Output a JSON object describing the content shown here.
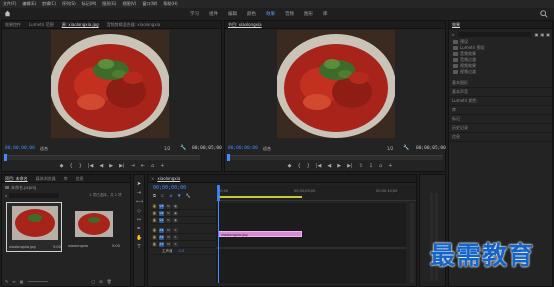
{
  "menu": [
    "文件(F)",
    "编辑(E)",
    "剪辑(C)",
    "序列(S)",
    "标记(M)",
    "图形(G)",
    "视图(V)",
    "窗口(W)",
    "帮助(H)"
  ],
  "workspaces": [
    "学习",
    "组件",
    "编辑",
    "颜色",
    "效果",
    "音频",
    "图形",
    "库"
  ],
  "active_workspace": "效果",
  "source_panel": {
    "tabs": [
      "效果控件",
      "Lumetri 范围",
      "源: xiaolongxia.jpg",
      "音频剪辑混合器: xiaolongxia"
    ],
    "timecode_left": "00;00;00;00",
    "fit": "适合",
    "ratio": "1/2",
    "timecode_right": "00;00;05;00",
    "buttons": [
      "◆",
      "{",
      "}",
      "|◀",
      "◀",
      "▶",
      "▶|",
      "⇥",
      "⇤",
      "⌂",
      "+"
    ]
  },
  "program_panel": {
    "title": "节目: xiaolongxia",
    "timecode_left": "00;00;00;00",
    "fit": "适合",
    "ratio": "1/2",
    "timecode_right": "00;00;05;00",
    "buttons": [
      "◆",
      "{",
      "}",
      "|◀",
      "◀",
      "▶",
      "▶|",
      "⇧",
      "⇩",
      "⌂",
      "+"
    ]
  },
  "right_panel": {
    "header": "效果",
    "tree": [
      "预设",
      "Lumetri 预设",
      "音频效果",
      "音频过渡",
      "视频效果",
      "视频过渡"
    ],
    "sections": [
      "基本图形",
      "基本声音",
      "Lumetri 颜色",
      "库",
      "标记",
      "历史记录",
      "信息"
    ]
  },
  "project_panel": {
    "tabs": [
      "项目: 未命名",
      "媒体浏览器",
      "库",
      "信息"
    ],
    "project_file": "未命名.prproj",
    "selected_count": "1 项已选择，共 2 项",
    "items": [
      {
        "name": "xiaolongxia.jpg",
        "duration": "5:00"
      },
      {
        "name": "xiaolongxia",
        "duration": "5:00"
      }
    ]
  },
  "timeline": {
    "tab": "xiaolongxia",
    "timecode": "00;00;00;00",
    "ruler": [
      "00;00",
      "00;00;05;00",
      "00;00;10;00"
    ],
    "video_tracks": [
      "V3",
      "V2",
      "V1"
    ],
    "audio_tracks": [
      "A1",
      "A2",
      "A3"
    ],
    "master": "主声道",
    "master_value": "0.0",
    "clip_label": "xiaolongxia.jpg"
  },
  "watermark": "最需教育",
  "colors": {
    "accent_blue": "#3f8cff",
    "clip_pink": "#d98bd8",
    "watermark": "#1565c8"
  }
}
